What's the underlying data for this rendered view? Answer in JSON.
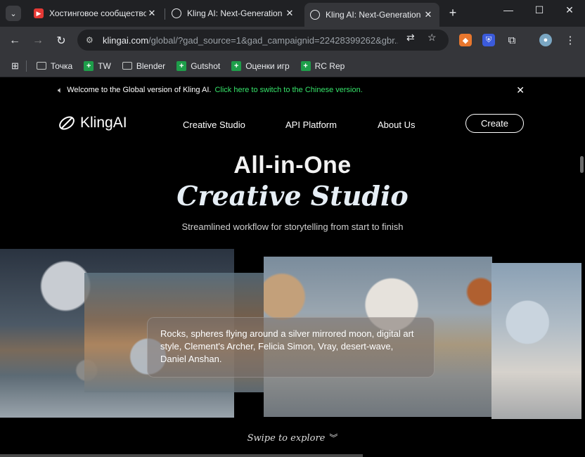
{
  "browser": {
    "tabs": [
      {
        "title": "Хостинговое сообщество",
        "favicon": "red-play-icon"
      },
      {
        "title": "Kling AI: Next-Generation A",
        "favicon": "kling-icon"
      },
      {
        "title": "Kling AI: Next-Generation A",
        "favicon": "kling-icon",
        "active": true
      }
    ],
    "url_host": "klingai.com",
    "url_path": "/global/?gad_source=1&gad_campaignid=22428399262&gbr...",
    "bookmarks": [
      {
        "label": "Точка",
        "icon": "folder-icon"
      },
      {
        "label": "TW",
        "icon": "green-plus-icon"
      },
      {
        "label": "Blender",
        "icon": "folder-icon"
      },
      {
        "label": "Gutshot",
        "icon": "green-plus-icon"
      },
      {
        "label": "Оценки игр",
        "icon": "green-plus-icon"
      },
      {
        "label": "RC Rep",
        "icon": "green-plus-icon"
      }
    ]
  },
  "announce": {
    "text": "Welcome to the Global version of Kling AI.",
    "link": "Click here to switch to the Chinese version."
  },
  "site": {
    "logo": "KlingAI",
    "nav": [
      "Creative Studio",
      "API Platform",
      "About Us"
    ],
    "cta": "Create"
  },
  "hero": {
    "line1": "All-in-One",
    "line2": "Creative Studio",
    "subtitle": "Streamlined workflow for storytelling from start to finish"
  },
  "prompt": "Rocks, spheres flying around a silver mirrored moon, digital art style, Clement's Archer, Felicia Simon, Vray, desert-wave, Daniel Anshan.",
  "swipe": "Swipe to explore",
  "colors": {
    "accent_link": "#36e36a"
  }
}
